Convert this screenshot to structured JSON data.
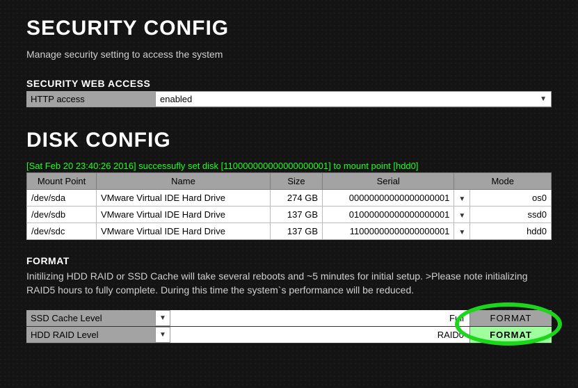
{
  "security": {
    "title": "SECURITY CONFIG",
    "subtitle": "Manage security setting to access the system",
    "web_access_label": "SECURITY WEB ACCESS",
    "http_row_label": "HTTP access",
    "http_value": "enabled"
  },
  "disk": {
    "title": "DISK CONFIG",
    "status": "[Sat Feb 20 23:40:26 2016] successufly set disk [110000000000000000001] to mount point [hdd0]",
    "headers": {
      "mount": "Mount Point",
      "name": "Name",
      "size": "Size",
      "serial": "Serial",
      "mode": "Mode"
    },
    "rows": [
      {
        "mount": "/dev/sda",
        "name": "VMware Virtual IDE Hard Drive",
        "size": "274 GB",
        "serial": "00000000000000000001",
        "mode": "os0"
      },
      {
        "mount": "/dev/sdb",
        "name": "VMware Virtual IDE Hard Drive",
        "size": "137 GB",
        "serial": "01000000000000000001",
        "mode": "ssd0"
      },
      {
        "mount": "/dev/sdc",
        "name": "VMware Virtual IDE Hard Drive",
        "size": "137 GB",
        "serial": "11000000000000000001",
        "mode": "hdd0"
      }
    ]
  },
  "format": {
    "label": "FORMAT",
    "desc": "Initilizing HDD RAID or SSD Cache will take several reboots and ~5 minutes for initial setup. >Please note initializing RAID5 hours to fully complete. During this time the system`s performance will be reduced.",
    "rows": [
      {
        "label": "SSD Cache Level",
        "value": "Full",
        "button": "FORMAT",
        "active": false
      },
      {
        "label": "HDD RAID Level",
        "value": "RAID0",
        "button": "FORMAT",
        "active": true
      }
    ]
  }
}
